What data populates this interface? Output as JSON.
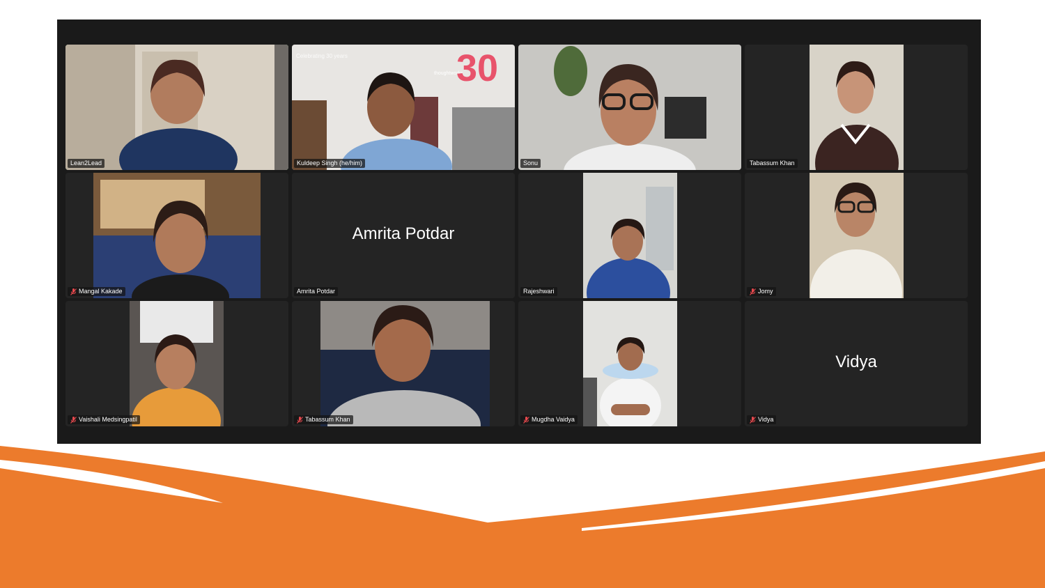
{
  "meeting": {
    "participants": [
      {
        "name": "Lean2Lead",
        "muted": false,
        "video": true,
        "active_speaker": true
      },
      {
        "name": "Kuldeep Singh (he/him)",
        "muted": false,
        "video": true,
        "banner_line1": "Celebrating 30 years",
        "banner_brand": "thoughtworks",
        "banner_number": "30"
      },
      {
        "name": "Sonu",
        "muted": false,
        "video": true
      },
      {
        "name": "Tabassum Khan",
        "muted": false,
        "video": true
      },
      {
        "name": "Mangal Kakade",
        "muted": true,
        "video": true
      },
      {
        "name": "Amrita Potdar",
        "muted": false,
        "video": false,
        "display_name": "Amrita Potdar"
      },
      {
        "name": "Rajeshwari",
        "muted": false,
        "video": true
      },
      {
        "name": "Jomy",
        "muted": true,
        "video": true
      },
      {
        "name": "Vaishali Medsingpatil",
        "muted": true,
        "video": true
      },
      {
        "name": "Tabassum Khan",
        "muted": true,
        "video": true
      },
      {
        "name": "Mugdha Vaidya",
        "muted": true,
        "video": true
      },
      {
        "name": "Vidya",
        "muted": true,
        "video": false,
        "display_name": "Vidya"
      }
    ]
  },
  "colors": {
    "window_bg": "#1a1a1a",
    "tile_bg": "#242424",
    "active_border": "#3fb950",
    "mute_icon": "#e5484d",
    "accent_orange": "#ec7b2c",
    "brand_pink": "#e8536b"
  }
}
